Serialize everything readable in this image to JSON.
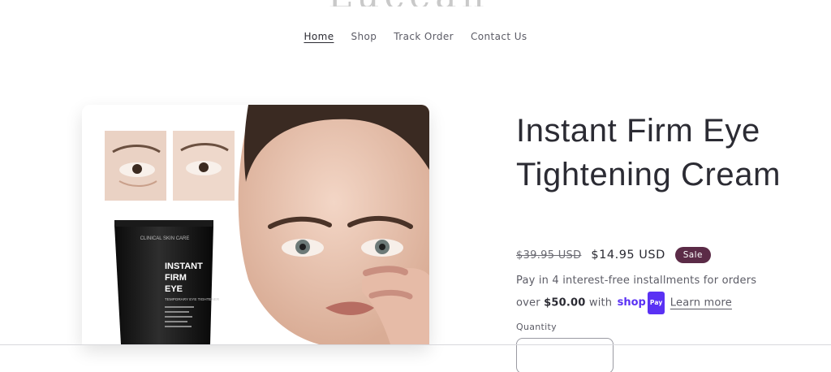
{
  "store": {
    "logo_text": "Lucean"
  },
  "nav": {
    "items": [
      {
        "label": "Home",
        "active": true
      },
      {
        "label": "Shop",
        "active": false
      },
      {
        "label": "Track Order",
        "active": false
      },
      {
        "label": "Contact Us",
        "active": false
      }
    ]
  },
  "product": {
    "title": "Instant Firm Eye Tightening Cream",
    "image_text": {
      "brand_line": "CLINICAL SKIN CARE",
      "name_line1": "INSTANT",
      "name_line2": "FIRM",
      "name_line3": "EYE",
      "sub_line": "TEMPORARY EYE TIGHTENER"
    },
    "compare_price": "$39.95 USD",
    "price": "$14.95 USD",
    "badge": "Sale",
    "installments_prefix": "Pay in 4 interest-free installments for orders over",
    "installments_amount": "$50.00",
    "installments_with": "with",
    "shop_pay_word": "shop",
    "shop_pay_pill": "Pay",
    "learn_more": "Learn more",
    "quantity_label": "Quantity"
  },
  "colors": {
    "badge_bg": "#5b2b47",
    "shop_pay": "#5a31f4",
    "text_primary": "#2b2b33"
  }
}
